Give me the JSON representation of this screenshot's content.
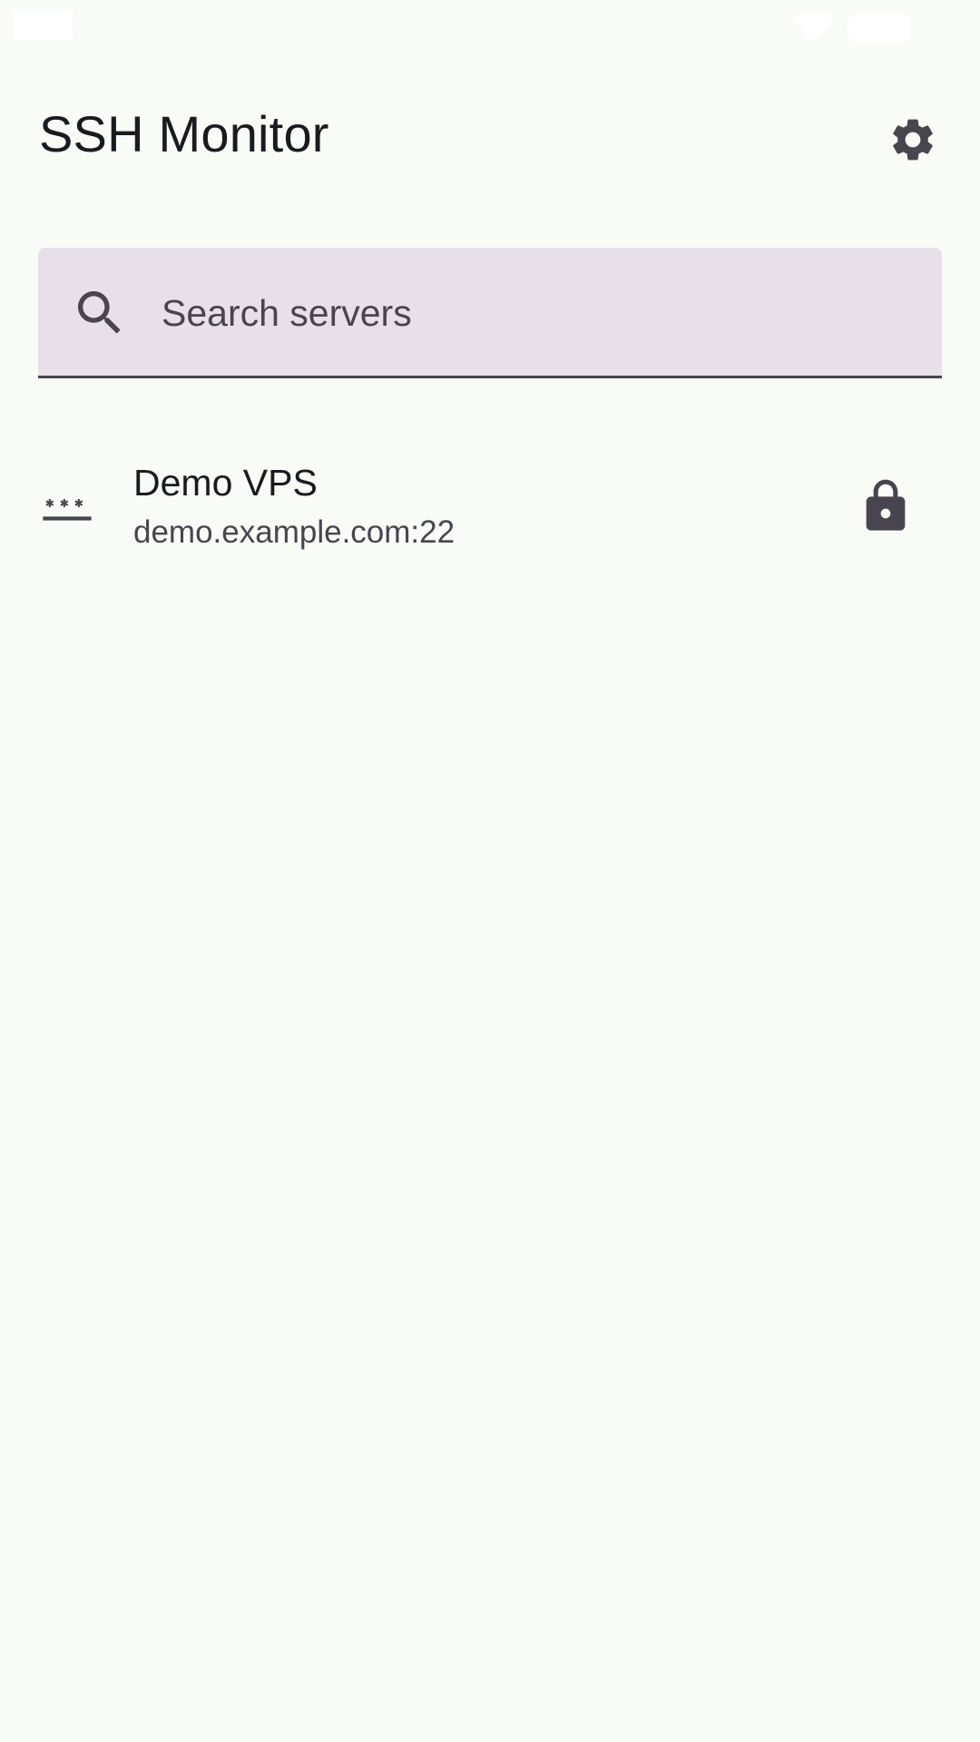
{
  "app": {
    "title": "SSH Monitor"
  },
  "search": {
    "placeholder": "Search servers",
    "value": ""
  },
  "servers": [
    {
      "name": "Demo VPS",
      "address": "demo.example.com:22",
      "auth_icon": "password-icon",
      "status_icon": "lock-icon"
    }
  ],
  "icons": {
    "settings": "gear-icon",
    "search": "search-icon"
  },
  "colors": {
    "background": "#f9fbf7",
    "search_field_bg": "#e7e0e8",
    "icon": "#49454f",
    "text_primary": "#1b1b1f",
    "text_secondary": "#49454f"
  }
}
